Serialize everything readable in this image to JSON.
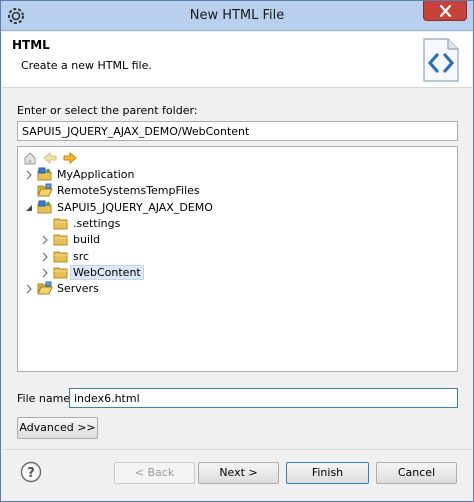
{
  "window": {
    "title": "New HTML File"
  },
  "header": {
    "title": "HTML",
    "description": "Create a new HTML file."
  },
  "parent_folder": {
    "label": "Enter or select the parent folder:",
    "value": "SAPUI5_JQUERY_AJAX_DEMO/WebContent"
  },
  "tree": {
    "items": [
      {
        "label": "MyApplication",
        "depth": 0,
        "twisty": "collapsed",
        "icon": "project-icon"
      },
      {
        "label": "RemoteSystemsTempFiles",
        "depth": 0,
        "twisty": "none",
        "icon": "folder-open-icon"
      },
      {
        "label": "SAPUI5_JQUERY_AJAX_DEMO",
        "depth": 0,
        "twisty": "expanded",
        "icon": "project-icon"
      },
      {
        "label": ".settings",
        "depth": 1,
        "twisty": "none",
        "icon": "folder-icon"
      },
      {
        "label": "build",
        "depth": 1,
        "twisty": "collapsed",
        "icon": "folder-icon"
      },
      {
        "label": "src",
        "depth": 1,
        "twisty": "collapsed",
        "icon": "folder-icon"
      },
      {
        "label": "WebContent",
        "depth": 1,
        "twisty": "collapsed",
        "icon": "folder-icon",
        "selected": true
      },
      {
        "label": "Servers",
        "depth": 0,
        "twisty": "collapsed",
        "icon": "folder-open-icon"
      }
    ]
  },
  "file_name": {
    "label": "File name:",
    "value": "index6.html"
  },
  "buttons": {
    "advanced": "Advanced >>",
    "back": "< Back",
    "next": "Next >",
    "finish": "Finish",
    "cancel": "Cancel"
  },
  "colors": {
    "titlebar": "#b8d0ed",
    "close": "#c7423a",
    "selection": "#dde8f6",
    "folder": "#e8c05a"
  }
}
